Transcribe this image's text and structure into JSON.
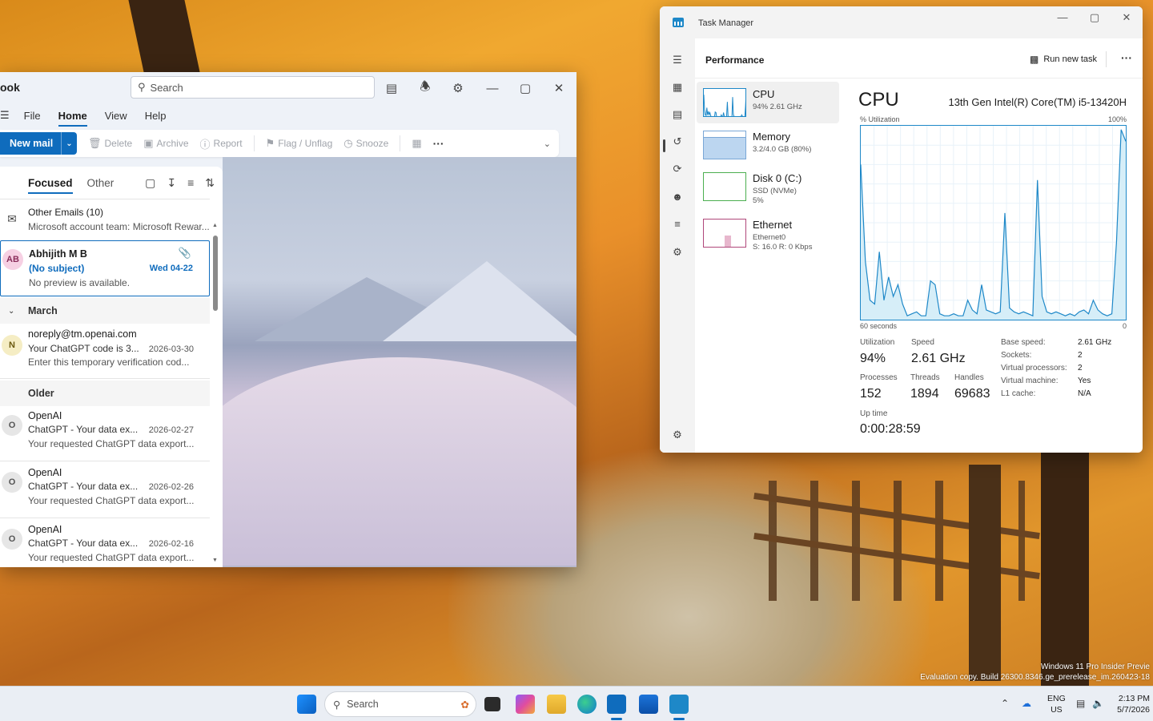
{
  "outlook": {
    "app_name": "ook",
    "search_placeholder": "Search",
    "menu": [
      "File",
      "Home",
      "View",
      "Help"
    ],
    "ribbon": {
      "new_mail": "New mail",
      "delete": "Delete",
      "archive": "Archive",
      "report": "Report",
      "flag": "Flag / Unflag",
      "snooze": "Snooze",
      "more": "···"
    },
    "tabs": {
      "focused": "Focused",
      "other": "Other"
    },
    "other_emails": {
      "title": "Other Emails (10)",
      "preview": "Microsoft account team: Microsoft Rewar..."
    },
    "selected_mail": {
      "initials": "AB",
      "sender": "Abhijith M B",
      "subject": "(No subject)",
      "date": "Wed 04-22",
      "preview": "No preview is available."
    },
    "groups": {
      "march": "March",
      "older": "Older"
    },
    "mails": [
      {
        "initial": "N",
        "sender": "noreply@tm.openai.com",
        "subject": "Your ChatGPT code is 3...",
        "date": "2026-03-30",
        "preview": "Enter this temporary verification cod..."
      },
      {
        "initial": "O",
        "sender": "OpenAI",
        "subject": "ChatGPT - Your data ex...",
        "date": "2026-02-27",
        "preview": "Your requested ChatGPT data export..."
      },
      {
        "initial": "O",
        "sender": "OpenAI",
        "subject": "ChatGPT - Your data ex...",
        "date": "2026-02-26",
        "preview": "Your requested ChatGPT data export..."
      },
      {
        "initial": "O",
        "sender": "OpenAI",
        "subject": "ChatGPT - Your data ex...",
        "date": "2026-02-16",
        "preview": "Your requested ChatGPT data export..."
      }
    ]
  },
  "taskmgr": {
    "title": "Task Manager",
    "section": "Performance",
    "run_new_task": "Run new task",
    "more": "···",
    "resources": [
      {
        "name": "CPU",
        "sub1": "94% 2.61 GHz",
        "sub2": "",
        "sub3": ""
      },
      {
        "name": "Memory",
        "sub1": "3.2/4.0 GB (80%)",
        "sub2": "",
        "sub3": ""
      },
      {
        "name": "Disk 0 (C:)",
        "sub1": "SSD (NVMe)",
        "sub2": "5%",
        "sub3": ""
      },
      {
        "name": "Ethernet",
        "sub1": "Ethernet0",
        "sub2": "S: 16.0 R: 0 Kbps",
        "sub3": ""
      }
    ],
    "cpu": {
      "heading": "CPU",
      "model": "13th Gen Intel(R) Core(TM) i5-13420H",
      "axis_top_left": "% Utilization",
      "axis_top_right": "100%",
      "axis_bottom_left": "60 seconds",
      "axis_bottom_right": "0",
      "utilization_label": "Utilization",
      "utilization": "94%",
      "speed_label": "Speed",
      "speed": "2.61 GHz",
      "processes_label": "Processes",
      "processes": "152",
      "threads_label": "Threads",
      "threads": "1894",
      "handles_label": "Handles",
      "handles": "69683",
      "uptime_label": "Up time",
      "uptime": "0:00:28:59",
      "details": [
        {
          "k": "Base speed:",
          "v": "2.61 GHz"
        },
        {
          "k": "Sockets:",
          "v": "2"
        },
        {
          "k": "Virtual processors:",
          "v": "2"
        },
        {
          "k": "Virtual machine:",
          "v": "Yes"
        },
        {
          "k": "L1 cache:",
          "v": "N/A"
        }
      ],
      "usage_history": [
        80,
        30,
        10,
        8,
        35,
        10,
        22,
        12,
        18,
        8,
        2,
        3,
        4,
        2,
        2,
        20,
        18,
        3,
        2,
        2,
        3,
        2,
        2,
        10,
        5,
        3,
        18,
        5,
        4,
        3,
        4,
        55,
        6,
        4,
        3,
        4,
        3,
        2,
        72,
        12,
        4,
        3,
        4,
        3,
        2,
        3,
        2,
        4,
        5,
        3,
        10,
        5,
        3,
        2,
        3,
        40,
        98,
        92
      ]
    }
  },
  "taskbar": {
    "search": "Search",
    "lang1": "ENG",
    "lang2": "US",
    "time": "2:13 PM",
    "date": "5/7/2026"
  },
  "watermark": {
    "line1": "Windows 11 Pro Insider Previe",
    "line2": "Evaluation copy. Build 26300.8346.ge_prerelease_im.260423-18"
  },
  "colors": {
    "accent": "#0f6cbd",
    "graph": "#1e88c8",
    "graph_fill": "#d6eef8"
  }
}
